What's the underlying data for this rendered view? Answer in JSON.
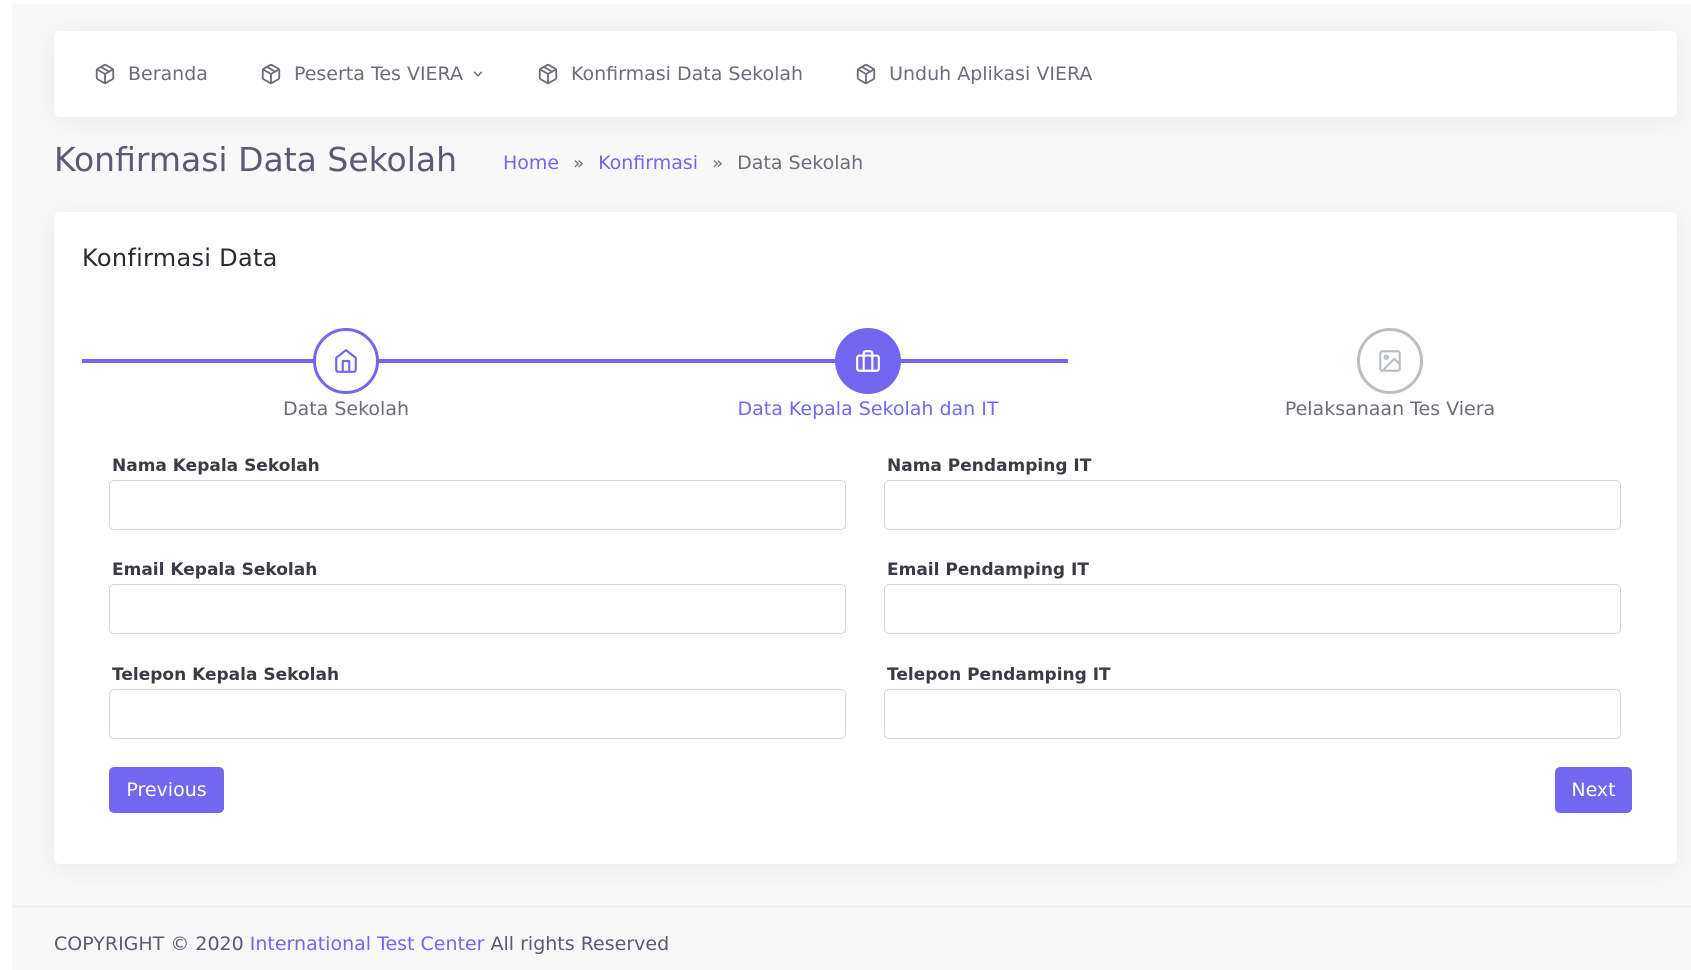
{
  "nav": {
    "items": [
      {
        "label": "Beranda",
        "icon": "package-icon"
      },
      {
        "label": "Peserta Tes VIERA",
        "icon": "package-icon",
        "has_dropdown": true
      },
      {
        "label": "Konfirmasi Data Sekolah",
        "icon": "package-icon"
      },
      {
        "label": "Unduh Aplikasi VIERA",
        "icon": "package-icon"
      }
    ]
  },
  "header": {
    "title": "Konfirmasi Data Sekolah",
    "breadcrumb": {
      "home": "Home",
      "separator1": "»",
      "parent": "Konfirmasi",
      "separator2": "»",
      "current": "Data Sekolah"
    }
  },
  "card": {
    "title": "Konfirmasi Data"
  },
  "stepper": {
    "steps": [
      {
        "label": "Data Sekolah",
        "icon": "home-icon",
        "state": "done"
      },
      {
        "label": "Data Kepala Sekolah dan IT",
        "icon": "briefcase-icon",
        "state": "active"
      },
      {
        "label": "Pelaksanaan Tes Viera",
        "icon": "image-icon",
        "state": "pending"
      }
    ]
  },
  "form": {
    "nama_kepala_label": "Nama Kepala Sekolah",
    "nama_kepala_value": "",
    "email_kepala_label": "Email Kepala Sekolah",
    "email_kepala_value": "",
    "telepon_kepala_label": "Telepon Kepala Sekolah",
    "telepon_kepala_value": "",
    "nama_it_label": "Nama Pendamping IT",
    "nama_it_value": "",
    "email_it_label": "Email Pendamping IT",
    "email_it_value": "",
    "telepon_it_label": "Telepon Pendamping IT",
    "telepon_it_value": ""
  },
  "buttons": {
    "previous": "Previous",
    "next": "Next"
  },
  "footer": {
    "prefix": "COPYRIGHT © 2020 ",
    "link": "International Test Center",
    "suffix": " All rights Reserved"
  },
  "colors": {
    "primary": "#7367f0",
    "pending": "#babfc7",
    "background": "#f8f8f8"
  }
}
